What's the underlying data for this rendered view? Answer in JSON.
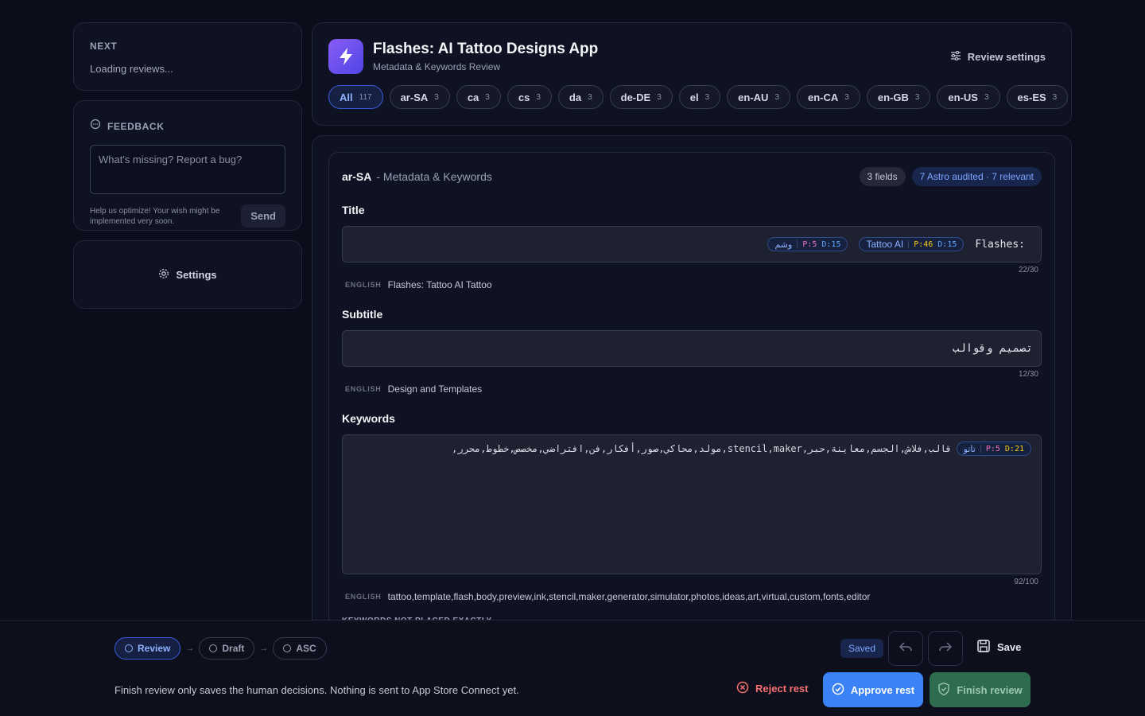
{
  "next": {
    "label": "NEXT",
    "status": "Loading reviews..."
  },
  "feedback": {
    "label": "FEEDBACK",
    "placeholder": "What's missing? Report a bug?",
    "help": "Help us optimize! Your wish might be implemented very soon.",
    "send": "Send"
  },
  "settings": {
    "label": "Settings"
  },
  "app": {
    "title": "Flashes: AI Tattoo Designs App",
    "subtitle": "Metadata & Keywords Review",
    "review_settings": "Review settings"
  },
  "tabs": [
    {
      "label": "All",
      "count": "117"
    },
    {
      "label": "ar-SA",
      "count": "3"
    },
    {
      "label": "ca",
      "count": "3"
    },
    {
      "label": "cs",
      "count": "3"
    },
    {
      "label": "da",
      "count": "3"
    },
    {
      "label": "de-DE",
      "count": "3"
    },
    {
      "label": "el",
      "count": "3"
    },
    {
      "label": "en-AU",
      "count": "3"
    },
    {
      "label": "en-CA",
      "count": "3"
    },
    {
      "label": "en-GB",
      "count": "3"
    },
    {
      "label": "en-US",
      "count": "3"
    },
    {
      "label": "es-ES",
      "count": "3"
    }
  ],
  "section": {
    "locale": "ar-SA",
    "heading_rest": "- Metadata & Keywords",
    "fields_badge": "3 fields",
    "audit_badge": "7 Astro audited · 7 relevant"
  },
  "title_field": {
    "label": "Title",
    "chip1": {
      "word": "وشم",
      "p": "P:5",
      "d": "D:15"
    },
    "chip2": {
      "word": "Tattoo AI",
      "p": "P:46",
      "d": "D:15"
    },
    "text": "Flashes:",
    "counter": "22/30",
    "english_tag": "ENGLISH",
    "english": "Flashes: Tattoo AI Tattoo"
  },
  "subtitle_field": {
    "label": "Subtitle",
    "text": "تصميم وقوالب",
    "counter": "12/30",
    "english_tag": "ENGLISH",
    "english": "Design and Templates"
  },
  "keywords_field": {
    "label": "Keywords",
    "text": "قالب,فلاش,الجسم,معاينة,حبر,stencil,maker,مولد,محاكي,صور,أفكار,فن,افتراضي,مخصص,خطوط,محرر,",
    "chip": {
      "word": "تاتو",
      "p": "P:5",
      "d": "D:21"
    },
    "counter": "92/100",
    "english_tag": "ENGLISH",
    "english": "tattoo,template,flash,body,preview,ink,stencil,maker,generator,simulator,photos,ideas,art,virtual,custom,fonts,editor"
  },
  "not_placed": {
    "label": "KEYWORDS NOT PLACED EXACTLY"
  },
  "footer": {
    "steps": [
      "Review",
      "Draft",
      "ASC"
    ],
    "saved": "Saved",
    "save": "Save",
    "note": "Finish review only saves the human decisions. Nothing is sent to App Store Connect yet.",
    "reject": "Reject rest",
    "approve": "Approve rest",
    "finish": "Finish review"
  },
  "colors": {
    "accent": "#3b82f6",
    "finish": "#2f6b4f",
    "reject": "#f87171"
  }
}
